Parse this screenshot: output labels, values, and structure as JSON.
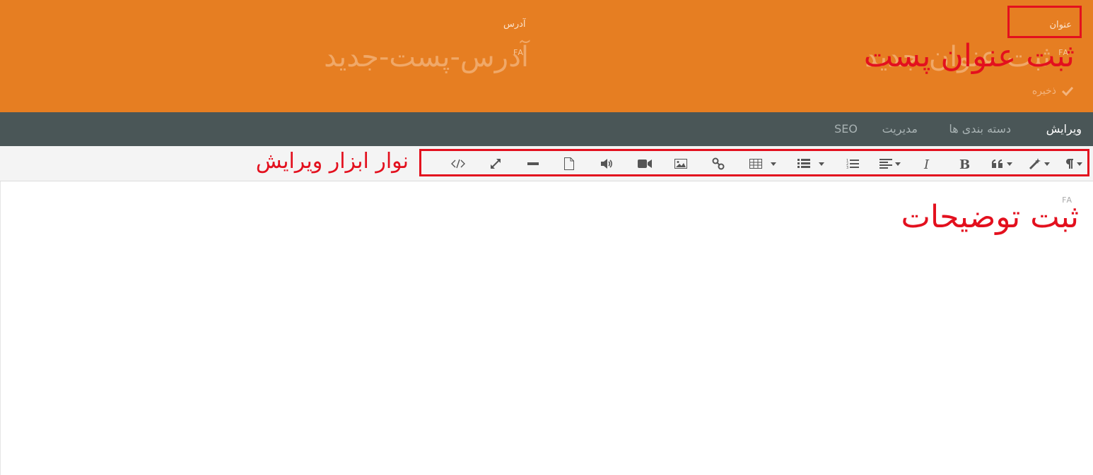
{
  "header": {
    "title_label": "عنوان",
    "title_lang": "FA",
    "title_placeholder": "ثبت عنوان جدید",
    "address_label": "آدرس",
    "address_lang": "FA",
    "address_value": "آدرس-پست-جدید",
    "save_label": "ذخیره",
    "save_icon": "check-icon",
    "background_color": "#e67e22"
  },
  "nav": {
    "tabs": [
      {
        "label": "ویرایش",
        "active": true
      },
      {
        "label": "دسته بندی ها",
        "active": false
      },
      {
        "label": "مدیریت",
        "active": false
      },
      {
        "label": "SEO",
        "active": false
      }
    ],
    "background_color": "#4a5657"
  },
  "toolbar": {
    "buttons": [
      {
        "name": "paragraph-style",
        "icon": "pilcrow-icon",
        "dropdown": true
      },
      {
        "name": "style",
        "icon": "magic-wand-icon",
        "dropdown": true
      },
      {
        "name": "blockquote",
        "icon": "quote-icon",
        "dropdown": true
      },
      {
        "name": "bold",
        "icon": "bold-icon",
        "dropdown": false
      },
      {
        "name": "italic",
        "icon": "italic-icon",
        "dropdown": false
      },
      {
        "name": "align",
        "icon": "align-icon",
        "dropdown": true
      },
      {
        "name": "ordered-list",
        "icon": "ordered-list-icon",
        "dropdown": false
      },
      {
        "name": "unordered-list",
        "icon": "unordered-list-icon",
        "dropdown": true
      },
      {
        "name": "table",
        "icon": "table-icon",
        "dropdown": true
      },
      {
        "name": "link",
        "icon": "link-icon",
        "dropdown": false
      },
      {
        "name": "image",
        "icon": "image-icon",
        "dropdown": false
      },
      {
        "name": "video",
        "icon": "video-icon",
        "dropdown": false
      },
      {
        "name": "audio",
        "icon": "volume-icon",
        "dropdown": false
      },
      {
        "name": "file",
        "icon": "file-icon",
        "dropdown": false
      },
      {
        "name": "horizontal-rule",
        "icon": "minus-icon",
        "dropdown": false
      },
      {
        "name": "fullscreen",
        "icon": "expand-icon",
        "dropdown": false
      },
      {
        "name": "code-view",
        "icon": "code-icon",
        "dropdown": false
      }
    ]
  },
  "editor": {
    "lang": "FA"
  },
  "annotations": {
    "title": "ثبت عنوان پست",
    "toolbar": "نوار ابزار ویرایش",
    "description": "ثبت توضیحات",
    "color": "#e3101e"
  }
}
